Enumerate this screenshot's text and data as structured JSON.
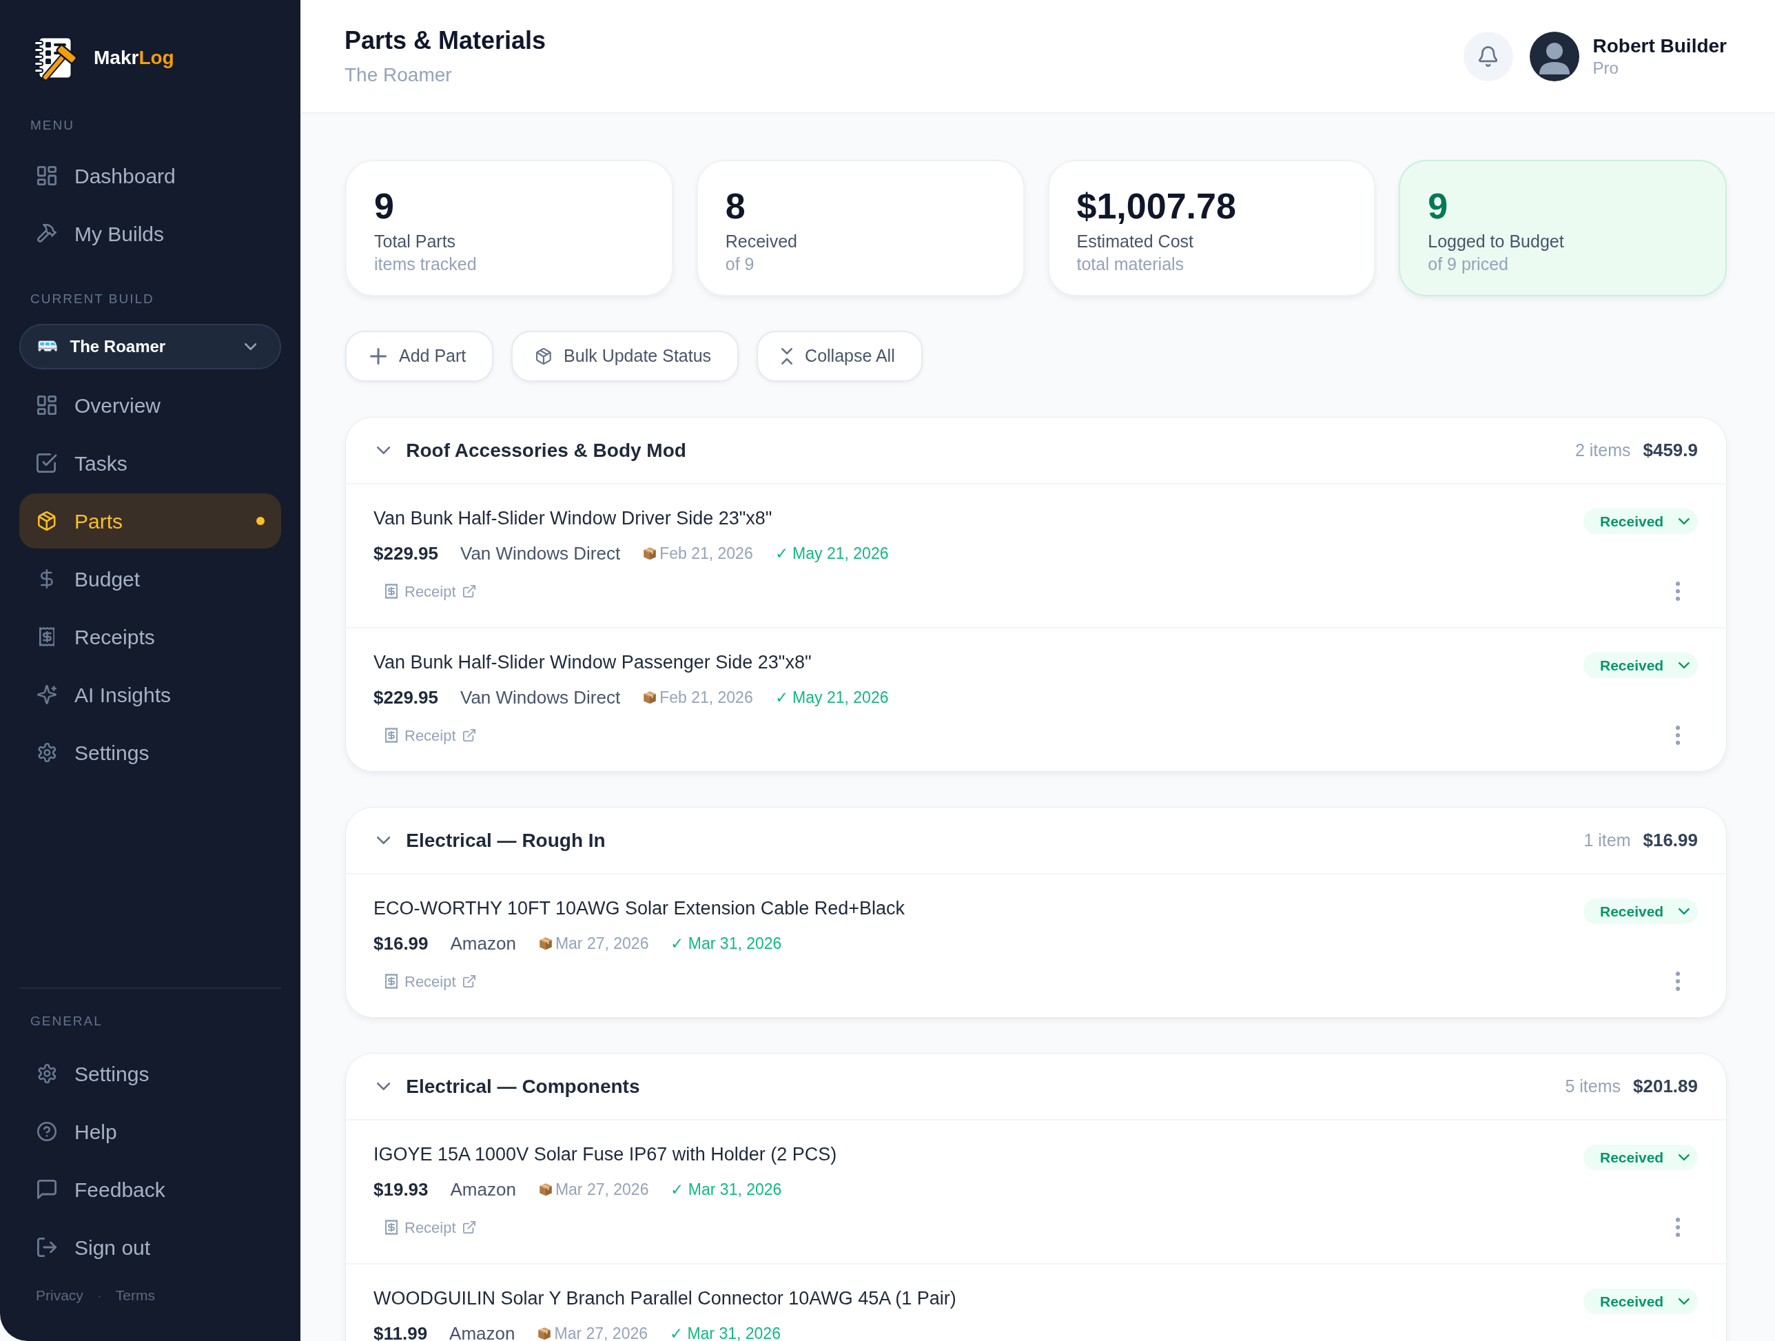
{
  "sidebar": {
    "brand": {
      "name": "Makr",
      "accent": "Log"
    },
    "menu": {
      "label": "MENU",
      "items": [
        {
          "label": "Dashboard",
          "selected": false
        },
        {
          "label": "My Builds",
          "selected": false
        }
      ]
    },
    "current_build": {
      "label": "CURRENT BUILD",
      "selector": {
        "value": "The Roamer"
      },
      "items": [
        {
          "label": "Overview",
          "selected": false
        },
        {
          "label": "Tasks",
          "selected": false
        },
        {
          "label": "Parts",
          "selected": true
        },
        {
          "label": "Budget",
          "selected": false
        },
        {
          "label": "Receipts",
          "selected": false
        },
        {
          "label": "AI Insights",
          "selected": false
        },
        {
          "label": "Settings",
          "selected": false
        }
      ]
    },
    "general": {
      "label": "GENERAL",
      "items": [
        {
          "label": "Settings",
          "selected": false
        },
        {
          "label": "Help",
          "selected": false
        },
        {
          "label": "Feedback",
          "selected": false
        },
        {
          "label": "Sign out",
          "selected": false
        }
      ]
    },
    "footer": {
      "links": [
        "Privacy",
        "Terms"
      ],
      "separator": "·"
    }
  },
  "header": {
    "title": "Parts & Materials",
    "subtitle": "The Roamer",
    "user": {
      "name": "Robert Builder",
      "plan": "Pro"
    }
  },
  "stats": [
    {
      "value": "9",
      "label": "Total Parts",
      "sub": "items tracked",
      "kind": "plain"
    },
    {
      "value": "8",
      "label": "Received",
      "sub": "of 9",
      "kind": "plain"
    },
    {
      "value": "$1,007.78",
      "label": "Estimated Cost",
      "sub": "total materials",
      "kind": "plain"
    },
    {
      "value": "9",
      "label": "Logged to Budget",
      "sub": "of 9 priced",
      "kind": "highlight"
    }
  ],
  "actions": [
    "Add Part",
    "Bulk Update Status",
    "Collapse All"
  ],
  "groups": [
    {
      "title": "Roof Accessories & Body Mod",
      "expanded": true,
      "count": "2 items",
      "total": "$459.9",
      "parts": [
        {
          "name": "Van Bunk Half-Slider Window Driver Side 23\"x8\"",
          "price": "$229.95",
          "vendor": "Van Windows Direct",
          "ordered": "Feb 21, 2026",
          "received": "✓ May 21, 2026",
          "status": "Received",
          "receipt": "Receipt"
        },
        {
          "name": "Van Bunk Half-Slider Window Passenger Side 23\"x8\"",
          "price": "$229.95",
          "vendor": "Van Windows Direct",
          "ordered": "Feb 21, 2026",
          "received": "✓ May 21, 2026",
          "status": "Received",
          "receipt": "Receipt"
        }
      ]
    },
    {
      "title": "Electrical — Rough In",
      "expanded": true,
      "count": "1 item",
      "total": "$16.99",
      "parts": [
        {
          "name": "ECO-WORTHY 10FT 10AWG Solar Extension Cable Red+Black",
          "price": "$16.99",
          "vendor": "Amazon",
          "ordered": "Mar 27, 2026",
          "received": "✓ Mar 31, 2026",
          "status": "Received",
          "receipt": "Receipt"
        }
      ]
    },
    {
      "title": "Electrical — Components",
      "expanded": true,
      "count": "5 items",
      "total": "$201.89",
      "parts": [
        {
          "name": "IGOYE 15A 1000V Solar Fuse IP67 with Holder (2 PCS)",
          "price": "$19.93",
          "vendor": "Amazon",
          "ordered": "Mar 27, 2026",
          "received": "✓ Mar 31, 2026",
          "status": "Received",
          "receipt": "Receipt"
        },
        {
          "name": "WOODGUILIN Solar Y Branch Parallel Connector 10AWG 45A (1 Pair)",
          "price": "$11.99",
          "vendor": "Amazon",
          "ordered": "Mar 27, 2026",
          "received": "✓ Mar 31, 2026",
          "status": "Received"
        }
      ]
    }
  ]
}
